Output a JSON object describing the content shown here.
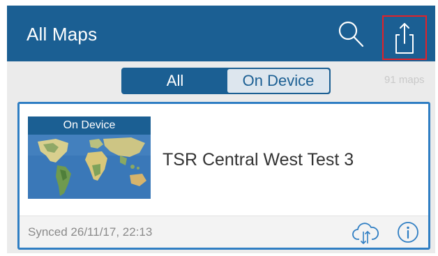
{
  "header": {
    "title": "All Maps",
    "search_icon": "search-icon",
    "share_icon": "share-icon",
    "color": "#1b5f93",
    "highlight_color": "#e32128"
  },
  "filter": {
    "options": [
      "All",
      "On Device"
    ],
    "selected": "All",
    "map_count": "91 maps"
  },
  "maps": [
    {
      "badge": "On Device",
      "name": "TSR Central West Test 3",
      "thumbnail": "world-map",
      "synced": "Synced 26/11/17, 22:13",
      "download_icon": "cloud-sync-icon",
      "info_icon": "info-icon"
    }
  ]
}
